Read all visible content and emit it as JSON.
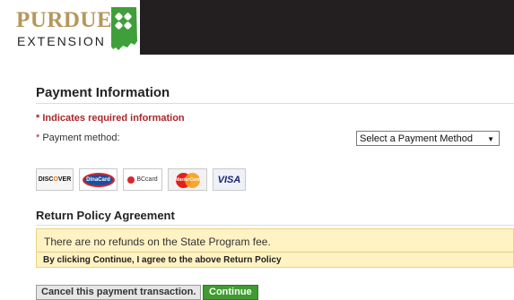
{
  "brand": {
    "name": "PURDUE",
    "subtitle": "EXTENSION",
    "clover_icon": "4-h-clover-icon",
    "gold": "#b5975a",
    "green": "#3f9f3a"
  },
  "payment": {
    "heading": "Payment Information",
    "required_note": "* Indicates required information",
    "method_required_mark": "*",
    "method_label": "Payment method:",
    "method_selected": "Select a Payment Method",
    "cards": [
      "DISCOVER",
      "DinaCard",
      "BCcard",
      "MasterCard",
      "VISA"
    ]
  },
  "return_policy": {
    "heading": "Return Policy Agreement",
    "text": "There are no refunds on the State Program fee.",
    "agreement": "By clicking Continue, I agree to the above Return Policy",
    "box_color": "#fff3c4"
  },
  "actions": {
    "cancel_label": "Cancel this payment transaction.",
    "continue_label": "Continue",
    "continue_color": "#3e9b2f"
  }
}
